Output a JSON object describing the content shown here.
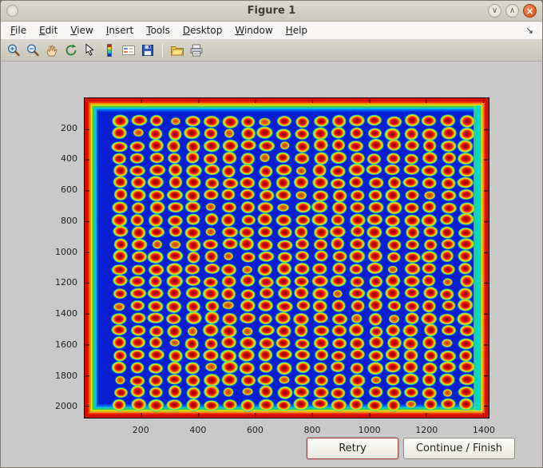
{
  "titlebar": {
    "title": "Figure 1",
    "window_buttons": [
      {
        "name": "minimize",
        "glyph": "∨"
      },
      {
        "name": "maximize",
        "glyph": "∧"
      },
      {
        "name": "close",
        "glyph": "×"
      }
    ]
  },
  "menubar": {
    "items": [
      "File",
      "Edit",
      "View",
      "Insert",
      "Tools",
      "Desktop",
      "Window",
      "Help"
    ],
    "dock_glyph": "↘"
  },
  "toolbar": {
    "items": [
      "zoom-in",
      "zoom-out",
      "pan",
      "rotate-3d",
      "data-cursor",
      "colorbar",
      "legend",
      "save",
      "separator",
      "open-folder",
      "print"
    ]
  },
  "plot": {
    "x_ticks": [
      200,
      400,
      600,
      800,
      1000,
      1200,
      1400
    ],
    "y_ticks": [
      200,
      400,
      600,
      800,
      1000,
      1200,
      1400,
      1600,
      1800,
      2000
    ],
    "x_range": [
      1,
      1420
    ],
    "y_range": [
      1,
      2075
    ],
    "spot_grid": {
      "rows": 24,
      "cols": 20,
      "x_start": 125,
      "x_step": 64,
      "y_start": 150,
      "y_step": 80
    },
    "palette": {
      "background": "#0a1ed2",
      "spot_core": "#8f0000",
      "spot_red": "#e00e00",
      "spot_orange": "#ff6a00",
      "spot_yellow": "#ffe100",
      "spot_green": "#86ee1c",
      "spot_cyan_rgb": "0,215,230",
      "edge_red": "#d40f00"
    }
  },
  "footer_buttons": {
    "retry": "Retry",
    "continue_finish": "Continue / Finish"
  },
  "colors": {
    "close_button": "#dd5a18",
    "content_background": "#c9c9c9"
  }
}
